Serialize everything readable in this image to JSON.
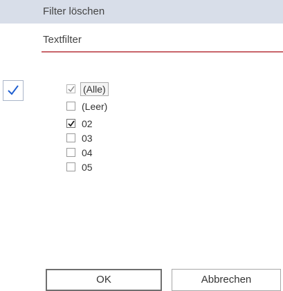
{
  "menu": {
    "clear_filter": "Filter löschen",
    "text_filter": "Textfilter"
  },
  "filter_items": [
    {
      "label": "(Alle)",
      "state": "partial"
    },
    {
      "label": "(Leer)",
      "state": "unchecked"
    },
    {
      "label": "02",
      "state": "checked"
    },
    {
      "label": "03",
      "state": "unchecked"
    },
    {
      "label": "04",
      "state": "unchecked"
    },
    {
      "label": "05",
      "state": "unchecked"
    }
  ],
  "buttons": {
    "ok": "OK",
    "cancel": "Abbrechen"
  },
  "colors": {
    "highlight": "#d8dee9",
    "underline": "#c8646a",
    "check_accent": "#1f5fd0"
  }
}
